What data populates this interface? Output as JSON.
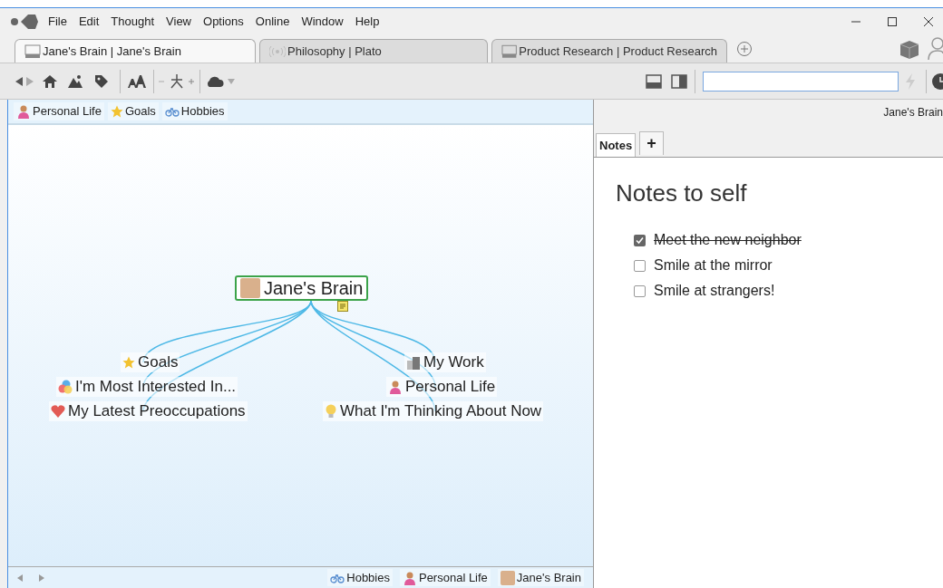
{
  "menu": [
    "File",
    "Edit",
    "Thought",
    "View",
    "Options",
    "Online",
    "Window",
    "Help"
  ],
  "tabs": [
    {
      "label": "Jane's Brain | Jane's Brain",
      "kind": "brain",
      "selected": true
    },
    {
      "label": "Philosophy | Plato",
      "kind": "remote",
      "selected": false
    },
    {
      "label": "Product Research | Product Research",
      "kind": "brain",
      "selected": false
    }
  ],
  "pins": [
    "Personal Life",
    "Goals",
    "Hobbies"
  ],
  "map": {
    "central": "Jane's Brain",
    "left": [
      "Goals",
      "I'm Most Interested In...",
      "My Latest Preoccupations"
    ],
    "right": [
      "My Work",
      "Personal Life",
      "What I'm Thinking About Now"
    ]
  },
  "breadcrumbs": [
    "Hobbies",
    "Personal Life",
    "Jane's Brain"
  ],
  "details": {
    "brain_name": "Jane's Brain",
    "tabs": [
      {
        "label": "Notes",
        "selected": true
      },
      {
        "label": "+",
        "selected": false
      }
    ],
    "title": "Notes to self",
    "todos": [
      {
        "text": "Meet the new neighbor",
        "checked": true
      },
      {
        "text": "Smile at the mirror",
        "checked": false
      },
      {
        "text": "Smile at strangers!",
        "checked": false
      }
    ]
  }
}
